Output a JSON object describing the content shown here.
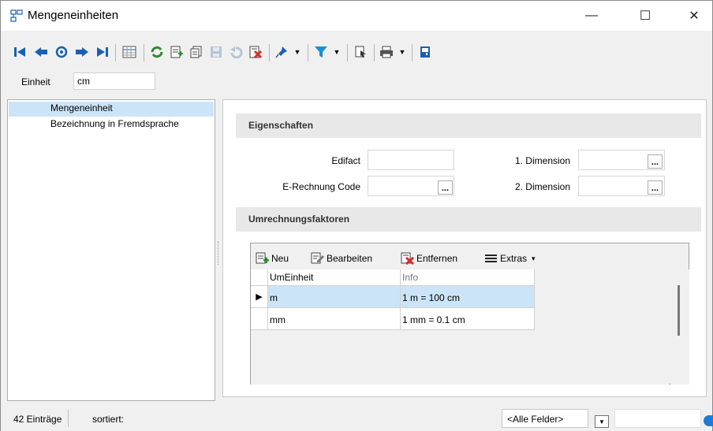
{
  "window": {
    "title": "Mengeneinheiten",
    "minimize_glyph": "—",
    "maximize_glyph": "☐",
    "close_glyph": "✕"
  },
  "toolbar": {
    "icons": [
      "first-record-icon",
      "previous-record-icon",
      "go-to-record-icon",
      "next-record-icon",
      "last-record-icon",
      "table-view-icon",
      "refresh-icon",
      "new-record-icon",
      "copy-record-icon",
      "save-icon",
      "undo-icon",
      "delete-icon",
      "pin-icon",
      "pin-dropdown-icon",
      "filter-icon",
      "filter-dropdown-icon",
      "select-icon",
      "print-icon",
      "print-dropdown-icon",
      "exit-icon"
    ]
  },
  "unit": {
    "label": "Einheit",
    "value": "cm"
  },
  "nav": {
    "items": [
      {
        "label": "Mengeneinheit",
        "selected": true
      },
      {
        "label": "Bezeichnung in Fremdsprache",
        "selected": false
      }
    ]
  },
  "eigenschaften": {
    "title": "Eigenschaften",
    "edifact_label": "Edifact",
    "edifact_value": "",
    "erechnung_label": "E-Rechnung Code",
    "erechnung_value": "",
    "dim1_label": "1. Dimension",
    "dim1_value": "",
    "dim2_label": "2. Dimension",
    "dim2_value": "",
    "ellipsis": "..."
  },
  "umrechnung": {
    "title": "Umrechnungsfaktoren",
    "toolbar": {
      "new_label": "Neu",
      "edit_label": "Bearbeiten",
      "delete_label": "Entfernen",
      "extras_label": "Extras",
      "extras_arrow": "▾"
    },
    "columns": [
      "UmEinheit",
      "Info"
    ],
    "rows": [
      {
        "umeinheit": "m",
        "info": "1 m = 100 cm",
        "selected": true
      },
      {
        "umeinheit": "mm",
        "info": "1 mm = 0.1 cm",
        "selected": false
      }
    ],
    "row_indicator": "▶"
  },
  "status": {
    "count": "42 Einträge",
    "sort_label": "sortiert:",
    "field_select": "<Alle Felder>",
    "search_value": ""
  },
  "colors": {
    "selection": "#cce4f7",
    "toolbar_blue": "#1a5fb4",
    "toolbar_green": "#2e8b2e",
    "toolbar_red": "#d32f2f"
  }
}
